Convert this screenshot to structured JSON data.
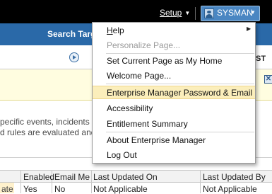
{
  "topbar": {
    "setup_label": "Setup",
    "user_label": "SYSMAN",
    "caret": "▼"
  },
  "header": {
    "search_label": "Search Target"
  },
  "toolbar": {
    "play_icon": "play-circle-icon",
    "partial_text": "ST"
  },
  "message_bar": {
    "close_icon": "close-icon",
    "close_glyph": "✕"
  },
  "description": {
    "line1": "pecific events, incidents or",
    "line2": "d rules are evaluated and a"
  },
  "table": {
    "columns": [
      "Enabled",
      "Email Me",
      "Last Updated On",
      "Last Updated By"
    ],
    "rows": [
      {
        "left_cell": "ate",
        "enabled": "Yes",
        "email_me": "No",
        "updated_on": "Not Applicable",
        "updated_by": "Not Applicable"
      }
    ]
  },
  "user_menu": {
    "items": [
      {
        "label": "Help",
        "accel": "H",
        "submenu": true,
        "enabled": true
      },
      {
        "label": "Personalize Page...",
        "accel": "",
        "enabled": false
      },
      {
        "label": "Set Current Page as My Home",
        "accel": "",
        "enabled": true
      },
      {
        "label": "Welcome Page...",
        "accel": "",
        "enabled": true
      },
      {
        "label": "Enterprise Manager Password & Email",
        "accel": "",
        "enabled": true,
        "highlighted": true
      },
      {
        "label": "Accessibility",
        "accel": "",
        "enabled": true
      },
      {
        "label": "Entitlement Summary",
        "accel": "",
        "enabled": true
      },
      {
        "label": "About Enterprise Manager",
        "accel": "",
        "enabled": true
      },
      {
        "label": "Log Out",
        "accel": "",
        "enabled": true
      }
    ],
    "submenu_arrow": "▶"
  },
  "colors": {
    "topbar": "#000000",
    "accent_blue": "#2a69a8",
    "user_button": "#4a86c2",
    "highlight": "#fbeebb",
    "message_bg": "#fffde0"
  }
}
